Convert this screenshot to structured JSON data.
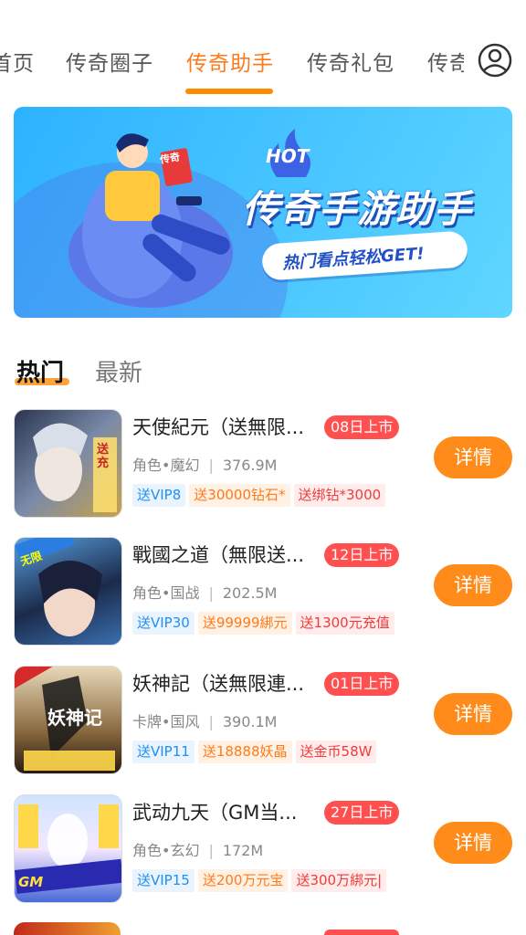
{
  "topnav": {
    "tabs": [
      {
        "label": "首页"
      },
      {
        "label": "传奇圈子"
      },
      {
        "label": "传奇助手"
      },
      {
        "label": "传奇礼包"
      },
      {
        "label": "传奇"
      }
    ],
    "active_tab": "传奇助手"
  },
  "banner": {
    "hot": "HOT",
    "title": "传奇手游助手",
    "subtitle": "热门看点轻松GET!",
    "phone_text": "传奇"
  },
  "section_tabs": {
    "hot": "热门",
    "new": "最新"
  },
  "games": [
    {
      "name": "天使紀元（送無限...",
      "badge": "08日上市",
      "category": "角色•魔幻",
      "size": "376.9M",
      "tags": [
        "送VIP8",
        "送30000钻石*",
        "送绑钻*3000"
      ],
      "button": "详情",
      "icon_text": "送充"
    },
    {
      "name": "戰國之道（無限送...",
      "badge": "12日上市",
      "category": "角色•国战",
      "size": "202.5M",
      "tags": [
        "送VIP30",
        "送99999綁元",
        "送1300元充值"
      ],
      "button": "详情",
      "icon_text": "无限"
    },
    {
      "name": "妖神記（送無限連...",
      "badge": "01日上市",
      "category": "卡牌•国风",
      "size": "390.1M",
      "tags": [
        "送VIP11",
        "送18888妖晶",
        "送金币58W"
      ],
      "button": "详情",
      "icon_text": "妖神记"
    },
    {
      "name": "武动九天（GM当...",
      "badge": "27日上市",
      "category": "角色•玄幻",
      "size": "172M",
      "tags": [
        "送VIP15",
        "送200万元宝",
        "送300万綁元|"
      ],
      "button": "详情",
      "icon_text": "GM"
    }
  ],
  "colors": {
    "accent": "#ff8c1a",
    "badge": "#ff4f4f",
    "tag_blue": "#1f8ff0",
    "tag_orange": "#ff7a1a",
    "tag_red": "#ee3b3b"
  }
}
